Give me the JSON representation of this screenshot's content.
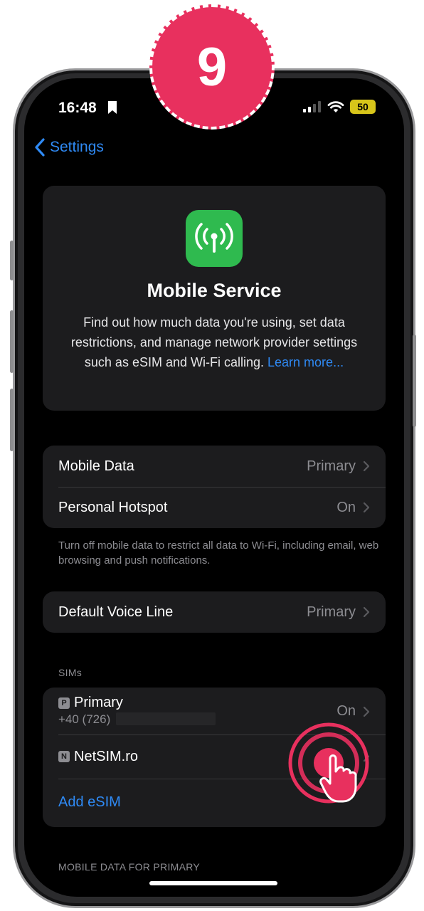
{
  "step_badge": {
    "number": "9",
    "color": "#e8305e"
  },
  "status_bar": {
    "time": "16:48",
    "battery": "50"
  },
  "nav": {
    "back_label": "Settings"
  },
  "hero": {
    "icon": "antenna-icon",
    "title": "Mobile Service",
    "description": "Find out how much data you're using, set data restrictions, and manage network provider settings such as eSIM and Wi-Fi calling.",
    "link": "Learn more..."
  },
  "data_group": {
    "rows": [
      {
        "label": "Mobile Data",
        "value": "Primary"
      },
      {
        "label": "Personal Hotspot",
        "value": "On"
      }
    ],
    "footnote": "Turn off mobile data to restrict all data to Wi-Fi, including email, web browsing and push notifications."
  },
  "voice_group": {
    "label": "Default Voice Line",
    "value": "Primary"
  },
  "sims": {
    "header": "SIMs",
    "items": [
      {
        "badge": "P",
        "name": "Primary",
        "number": "+40 (726)",
        "value": "On"
      },
      {
        "badge": "N",
        "name": "NetSIM.ro",
        "value": ""
      }
    ],
    "add_label": "Add eSIM"
  },
  "bottom_header": "MOBILE DATA FOR PRIMARY",
  "colors": {
    "accent": "#2f8af5",
    "group_bg": "#1c1c1e",
    "tile_green": "#2fba4f",
    "badge_pink": "#e8305e"
  }
}
